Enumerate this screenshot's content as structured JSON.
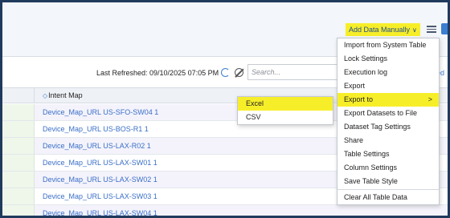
{
  "header": {
    "add_data_label": "Add Data Manually",
    "add_data_chevron": "∨"
  },
  "toolbar": {
    "last_refreshed": "Last Refreshed: 09/10/2025 07:05 PM",
    "search_placeholder": "Search...",
    "right_truncated": "ed"
  },
  "table": {
    "column_title": "Intent Map",
    "rows": [
      "Device_Map_URL US-SFO-SW04 1",
      "Device_Map_URL US-BOS-R1 1",
      "Device_Map_URL US-LAX-R02 1",
      "Device_Map_URL US-LAX-SW01 1",
      "Device_Map_URL US-LAX-SW02 1",
      "Device_Map_URL US-LAX-SW03 1",
      "Device_Map_URL US-LAX-SW04 1"
    ]
  },
  "menu": {
    "items": [
      "Import from System Table",
      "Lock Settings",
      "Execution log",
      "Export",
      "Export to",
      "Export Datasets to File",
      "Dataset Tag Settings",
      "Share",
      "Table Settings",
      "Column Settings",
      "Save Table Style",
      "Clear All Table Data"
    ],
    "submenu_arrow": ">"
  },
  "submenu": {
    "items": [
      "Excel",
      "CSV"
    ]
  },
  "colors": {
    "highlight": "#f7ee2a",
    "link": "#3a6fc8",
    "border": "#1f3a5c"
  },
  "icons": [
    "menu-icon",
    "refresh-icon",
    "hide-icon",
    "tree-icon",
    "chevron-right-icon",
    "chevron-down-icon"
  ]
}
